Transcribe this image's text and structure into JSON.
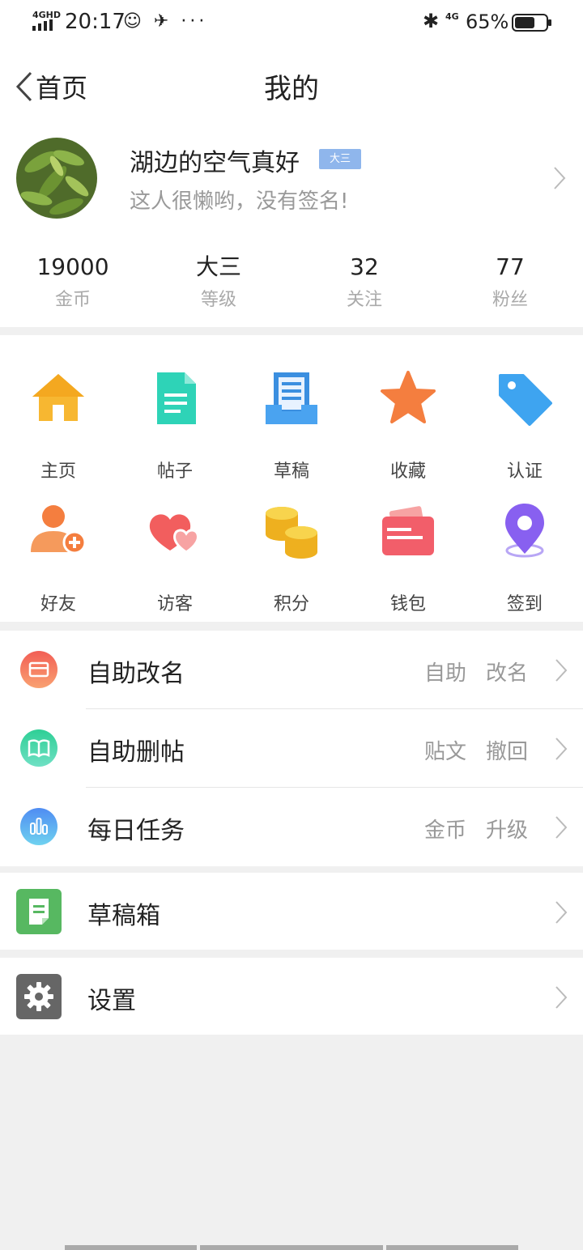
{
  "status": {
    "network": "4GHD",
    "time": "20:17",
    "extra_icons": "☺ ✈ ···",
    "network_right": "4G",
    "battery_pct": "65%",
    "battery_level": 0.65
  },
  "nav": {
    "back_label": "首页",
    "title": "我的"
  },
  "profile": {
    "name": "湖边的空气真好",
    "badge": "大三",
    "signature": "这人很懒哟，没有签名!"
  },
  "stats": [
    {
      "value": "19000",
      "label": "金币"
    },
    {
      "value": "大三",
      "label": "等级"
    },
    {
      "value": "32",
      "label": "关注"
    },
    {
      "value": "77",
      "label": "粉丝"
    }
  ],
  "grid": {
    "row1": [
      {
        "label": "主页",
        "icon": "home-icon"
      },
      {
        "label": "帖子",
        "icon": "post-icon"
      },
      {
        "label": "草稿",
        "icon": "draft-icon"
      },
      {
        "label": "收藏",
        "icon": "star-icon"
      },
      {
        "label": "认证",
        "icon": "tag-icon"
      }
    ],
    "row2": [
      {
        "label": "好友",
        "icon": "add-friend-icon"
      },
      {
        "label": "访客",
        "icon": "hearts-icon"
      },
      {
        "label": "积分",
        "icon": "coins-icon"
      },
      {
        "label": "钱包",
        "icon": "wallet-icon"
      },
      {
        "label": "签到",
        "icon": "location-pin-icon"
      }
    ]
  },
  "list1": [
    {
      "label": "自助改名",
      "tags": [
        "自助",
        "改名"
      ],
      "icon": "card-icon",
      "color": "#f2765a"
    },
    {
      "label": "自助删帖",
      "tags": [
        "贴文",
        "撤回"
      ],
      "icon": "book-icon",
      "color": "#3fd4a0"
    },
    {
      "label": "每日任务",
      "tags": [
        "金币",
        "升级"
      ],
      "icon": "bar-chart-icon",
      "color": "#5a9cf2"
    }
  ],
  "list2": {
    "label": "草稿箱",
    "icon": "draft-box-icon",
    "color": "#57b861"
  },
  "list3": {
    "label": "设置",
    "icon": "gear-icon",
    "color": "#666666"
  }
}
